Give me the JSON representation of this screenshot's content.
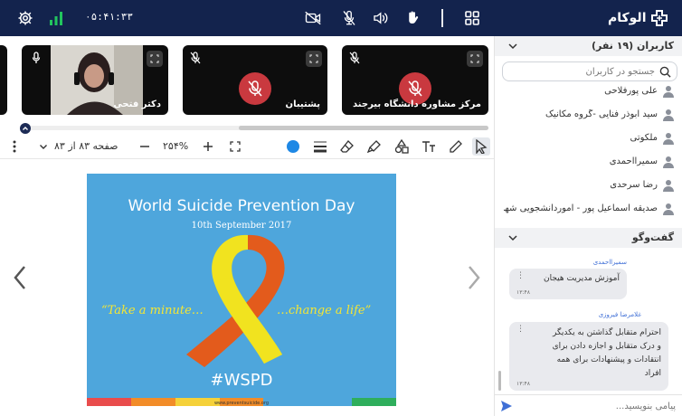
{
  "header": {
    "timer": "۰۵:۴۱:۳۳",
    "logo_text": "الوکام",
    "colors": {
      "bar": "#13234d",
      "signal": "#22c55e"
    }
  },
  "video_tiles": [
    {
      "name": "دکتر فتحی",
      "muted": false,
      "has_video": true
    },
    {
      "name": "پشتیبان",
      "muted": true,
      "has_video": false
    },
    {
      "name": "مرکز مشاوره دانشگاه بیرجند",
      "muted": true,
      "has_video": false
    }
  ],
  "toolbar": {
    "page_label": "صفحه ۸۳ از ۸۳",
    "zoom_label": "۲۵۴%",
    "active_color": "#1e88e5"
  },
  "slide": {
    "title": "World Suicide Prevention Day",
    "date": "10th September 2017",
    "quote_left": "“Take a minute…",
    "quote_right": "…change a life”",
    "hashtag": "#WSPD",
    "footer_url": "www.preventsuicide.org",
    "background": "#4ea6dc"
  },
  "users_panel": {
    "title": "کاربران (۱۹ نفر)",
    "search_placeholder": "جستجو در کاربران",
    "users": [
      "علی پورفلاحی",
      "سید ابوذر فنایی -گروه مکانیک",
      "ملکوتی",
      "سمیرااحمدی",
      "رضا سرحدی",
      "صدیقه اسماعیل پور - اموردانشجویی شهر..."
    ]
  },
  "chat_panel": {
    "title": "گفت‌وگو",
    "input_placeholder": "پیامی بنویسید...",
    "messages": [
      {
        "author": "سمیرااحمدی",
        "lines": [
          "آموزش مدیریت هیجان"
        ],
        "time": "۱۳:۴۸"
      },
      {
        "author": "غلامرضا فیروزی",
        "lines": [
          "احترام متقابل گذاشتن به یکدیگر",
          "و درک متقابل و اجازه دادن برای",
          "انتقادات و پیشنهادات برای همه",
          "افراد"
        ],
        "time": "۱۳:۴۸"
      }
    ]
  }
}
